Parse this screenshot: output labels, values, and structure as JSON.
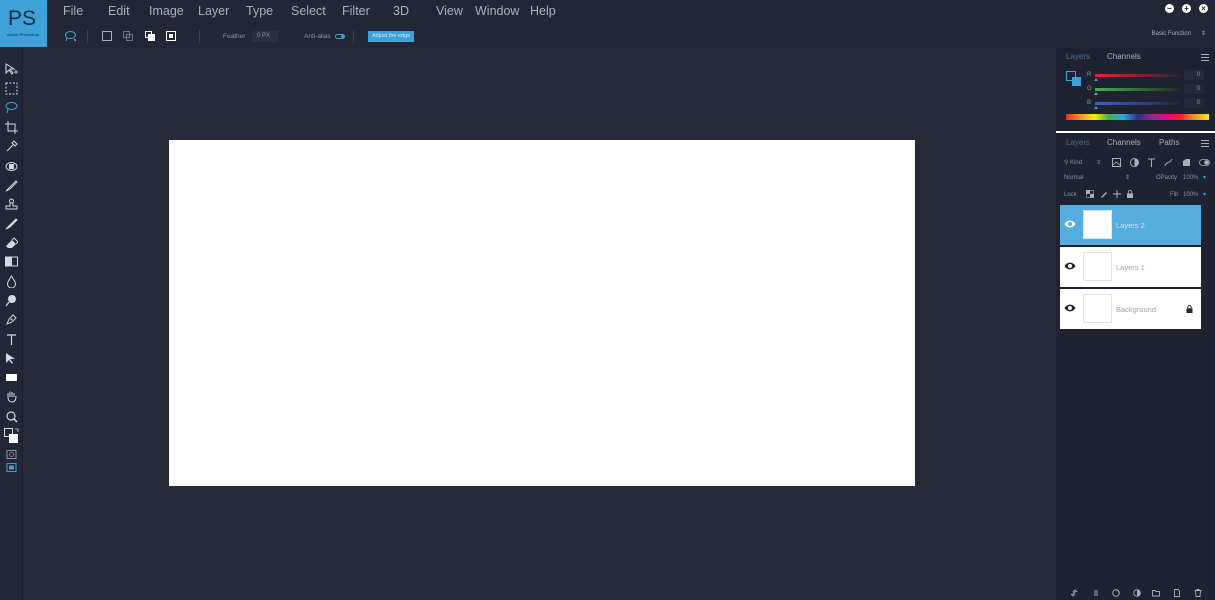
{
  "app": {
    "logo_text": "PS",
    "logo_subtext": "Adobe Photoshop",
    "brand_color": "#3ea1da"
  },
  "menu": [
    "File",
    "Edit",
    "Image",
    "Layer",
    "Type",
    "Select",
    "Filter",
    "3D",
    "View",
    "Window",
    "Help"
  ],
  "window_controls": [
    "minimize-icon",
    "maximize-icon",
    "close-icon"
  ],
  "options": {
    "feather_label": "Feather",
    "feather_value": "0 PX",
    "antialias_label": "Anti-alias",
    "adjust_button": "Adjust the edge",
    "workspace_select": "Basic Function"
  },
  "tools": [
    "move-tool-icon",
    "marquee-tool-icon",
    "lasso-tool-icon",
    "crop-tool-icon",
    "eyedropper-tool-icon",
    "healing-brush-icon",
    "brush-tool-icon",
    "stamp-tool-icon",
    "history-brush-icon",
    "eraser-tool-icon",
    "gradient-tool-icon",
    "blur-tool-icon",
    "dodge-tool-icon",
    "pen-tool-icon",
    "type-tool-icon",
    "path-selection-icon",
    "rectangle-tool-icon",
    "hand-tool-icon",
    "zoom-tool-icon",
    "color-swatch-icon",
    "quick-mask-icon",
    "screen-mode-icon"
  ],
  "color_panel": {
    "tabs": [
      "Layers",
      "Channels"
    ],
    "active_tab": "Channels",
    "channels": [
      {
        "label": "R",
        "value": "0",
        "color": "#e12a2a"
      },
      {
        "label": "G",
        "value": "0",
        "color": "#3fb549"
      },
      {
        "label": "B",
        "value": "0",
        "color": "#3f5fd8"
      }
    ]
  },
  "layers_panel": {
    "tabs": [
      "Layers",
      "Channels",
      "Paths"
    ],
    "active_tab": "Channels",
    "filter_label": "Kind",
    "blend_mode": "Normal",
    "opacity_label": "OPacity",
    "opacity_value": "100%",
    "lock_label": "Lock",
    "fill_label": "Fill",
    "fill_value": "100%",
    "layers": [
      {
        "name": "Layers 2",
        "selected": true,
        "locked": false
      },
      {
        "name": "Layers 1",
        "selected": false,
        "locked": false
      },
      {
        "name": "Background",
        "selected": false,
        "locked": true
      }
    ],
    "footer_icons": [
      "link-icon",
      "fx-icon",
      "mask-icon",
      "adjustment-icon",
      "folder-icon",
      "new-layer-icon",
      "trash-icon"
    ]
  }
}
